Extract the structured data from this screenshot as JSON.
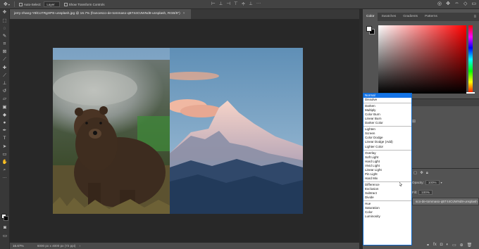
{
  "options_bar": {
    "auto_select_label": "Auto-Select:",
    "auto_select_target": "Layer",
    "transform_controls_label": "Show Transform Controls"
  },
  "document": {
    "tab_title": "jerry-zhang-Y8lCoTRgHPE-unsplash.jpg @ 16.7% (francesco-de-tommaso-qBT44OJWNd8-unsplash, RGB/8*)",
    "tab_close": "×"
  },
  "status": {
    "zoom": "16.67%",
    "dimensions": "6000 px x 4000 px (72 ppi)"
  },
  "color_panel": {
    "tabs": [
      "Color",
      "Swatches",
      "Gradients",
      "Patterns"
    ],
    "foreground": "#ffffff",
    "background": "#000000"
  },
  "layers_panel": {
    "opacity_label": "Opacity:",
    "opacity_value": "100%",
    "fill_label": "Fill:",
    "fill_value": "100%",
    "layer_name": "sco-de-tommaso-qBT44OJWNd8-unsplash"
  },
  "blend_modes": {
    "groups": [
      [
        "Normal",
        "Dissolve"
      ],
      [
        "Darken",
        "Multiply",
        "Color Burn",
        "Linear Burn",
        "Darker Color"
      ],
      [
        "Lighten",
        "Screen",
        "Color Dodge",
        "Linear Dodge (Add)",
        "Lighter Color"
      ],
      [
        "Overlay",
        "Soft Light",
        "Hard Light",
        "Vivid Light",
        "Linear Light",
        "Pin Light",
        "Hard Mix"
      ],
      [
        "Difference",
        "Exclusion",
        "Subtract",
        "Divide"
      ],
      [
        "Hue",
        "Saturation",
        "Color",
        "Luminosity"
      ]
    ],
    "selected": "Normal",
    "hovered": "Linear Light"
  }
}
